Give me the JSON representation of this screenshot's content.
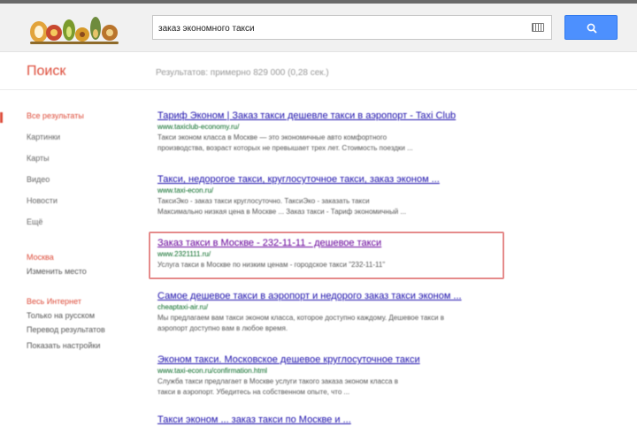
{
  "header": {
    "search_value": "заказ экономного такси",
    "logo_name": "search-engine-logo"
  },
  "subbar": {
    "brand": "Поиск",
    "stats": "Результатов: примерно 829 000 (0,28 сек.)"
  },
  "sidebar": {
    "items": [
      {
        "label": "Все результаты",
        "style": "active"
      },
      {
        "label": "Картинки",
        "style": ""
      },
      {
        "label": "Карты",
        "style": ""
      },
      {
        "label": "Видео",
        "style": ""
      },
      {
        "label": "Новости",
        "style": ""
      },
      {
        "label": "Ещё",
        "style": ""
      },
      {
        "label": "Москва",
        "style": "red"
      },
      {
        "label": "Изменить место",
        "style": "sub"
      },
      {
        "label": "Весь Интернет",
        "style": "red"
      },
      {
        "label": "Только на русском",
        "style": "sub"
      },
      {
        "label": "Перевод результатов",
        "style": "sub"
      },
      {
        "label": "Показать настройки",
        "style": "sub"
      }
    ]
  },
  "results": [
    {
      "title": "Тариф Эконом | Заказ такси дешевле такси в аэропорт - Taxi Club",
      "url": "www.taxiclub-economy.ru/",
      "snippet1": "Такси эконом класса в Москве — это экономичные авто комфортного",
      "snippet2": "производства, возраст которых не превышает трех лет. Стоимость поездки ...",
      "visited": false
    },
    {
      "title": "Такси, недорогое такси, круглосуточное такси, заказ эконом ...",
      "url": "www.taxi-econ.ru/",
      "snippet1": "ТаксиЭко - заказ такси круглосуточно. ТаксиЭко - заказать такси",
      "snippet2": "Максимально низкая цена в Москве ... Заказ такси - Тариф экономичный ...",
      "visited": false
    },
    {
      "title": "Заказ такси в Москве - 232-11-11 - дешевое такси",
      "url": "www.2321111.ru/",
      "snippet1": "Услуга такси в Москве по низким ценам - городское такси \"232-11-11\"",
      "snippet2": "",
      "visited": true
    },
    {
      "title": "Самое дешевое такси в аэропорт и недорого заказ такси эконом ...",
      "url": "cheaptaxi-air.ru/",
      "snippet1": "Мы предлагаем вам такси эконом класса, которое доступно каждому. Дешевое такси в",
      "snippet2": "аэропорт доступно вам в любое время.",
      "visited": false
    },
    {
      "title": "Эконом такси. Московское дешевое круглосуточное такси",
      "url": "www.taxi-econ.ru/confirmation.html",
      "snippet1": "Служба такси предлагает в Москве услуги такого заказа эконом класса в",
      "snippet2": "такси в аэропорт. Убедитесь на собственном опыте, что ...",
      "visited": false
    },
    {
      "title": "Такси эконом ... заказ такси по Москве и ...",
      "url": "",
      "snippet1": "",
      "snippet2": "",
      "visited": false
    }
  ]
}
